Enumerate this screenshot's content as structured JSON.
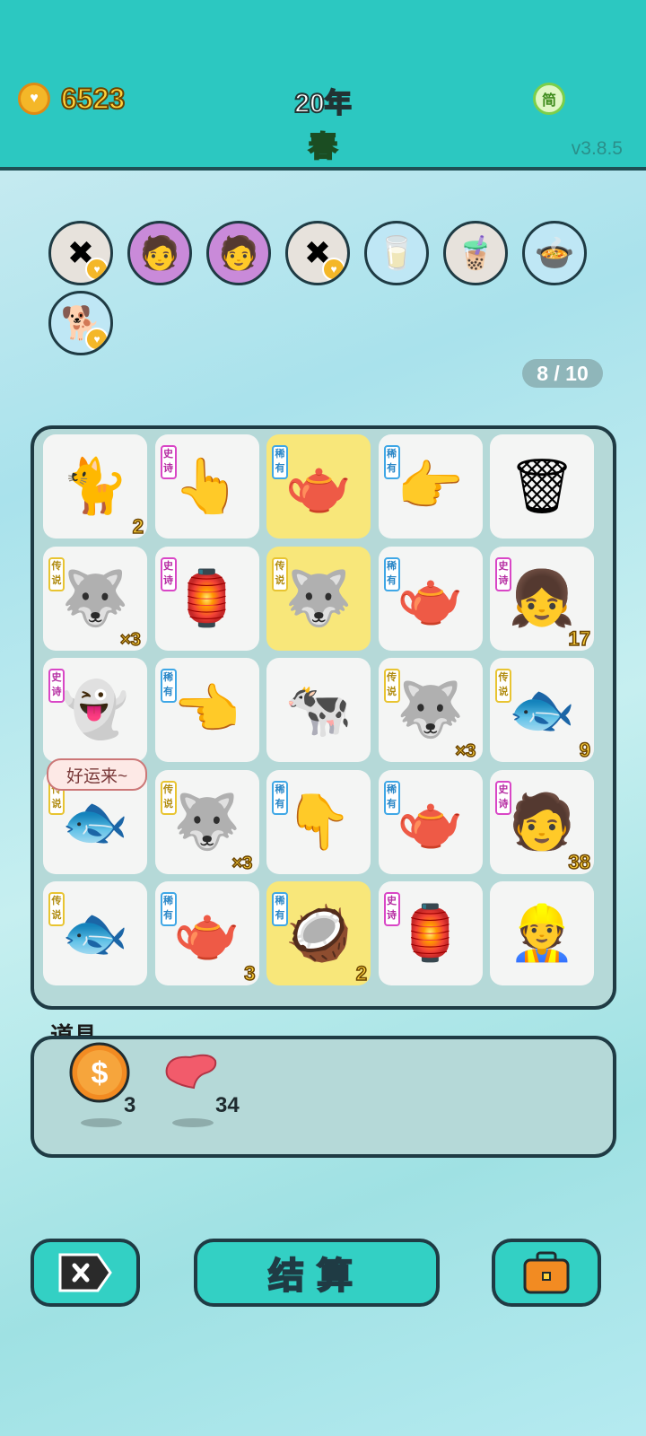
{
  "header": {
    "coins": "6523",
    "year": "20年",
    "season": "春",
    "lang": "简",
    "version": "v3.8.5"
  },
  "trail": [
    {
      "icon": "remove-tag-icon",
      "glyph": "✖"
    },
    {
      "icon": "lucky-man-icon",
      "glyph": "🧑"
    },
    {
      "icon": "lucky-man-icon",
      "glyph": "🧑"
    },
    {
      "icon": "remove-tag-icon",
      "glyph": "✖"
    },
    {
      "icon": "milk-jug-icon",
      "glyph": "🥛"
    },
    {
      "icon": "bubble-tea-icon",
      "glyph": "🧋"
    },
    {
      "icon": "duck-pot-icon",
      "glyph": "🍲"
    },
    {
      "icon": "husky-icon",
      "glyph": "🐕"
    }
  ],
  "spin_counter": "8 / 10",
  "board": [
    {
      "icon": "cat-icon",
      "glyph": "🐈",
      "count": "2"
    },
    {
      "icon": "pointing-hand-icon",
      "glyph": "👆",
      "tag": "史诗",
      "tagType": "epic"
    },
    {
      "icon": "teapot-icon",
      "glyph": "🫖",
      "tag": "稀有",
      "tagType": "rare",
      "highlight": true
    },
    {
      "icon": "pointing-hand-icon",
      "glyph": "👉",
      "tag": "稀有",
      "tagType": "rare"
    },
    {
      "icon": "garbage-bag-icon",
      "glyph": "🗑"
    },
    {
      "icon": "king-husky-icon",
      "glyph": "🐺",
      "tag": "传说",
      "tagType": "legend",
      "mult": "×3"
    },
    {
      "icon": "rabbit-house-icon",
      "glyph": "🏮",
      "tag": "史诗",
      "tagType": "epic"
    },
    {
      "icon": "king-husky-icon",
      "glyph": "🐺",
      "tag": "传说",
      "tagType": "legend",
      "highlight": true
    },
    {
      "icon": "teapot-icon",
      "glyph": "🫖",
      "tag": "稀有",
      "tagType": "rare"
    },
    {
      "icon": "girl-icon",
      "glyph": "👧",
      "tag": "史诗",
      "tagType": "epic",
      "count": "17"
    },
    {
      "icon": "ghost-icon",
      "glyph": "👻",
      "tag": "史诗",
      "tagType": "epic"
    },
    {
      "icon": "pointing-hand-icon",
      "glyph": "👈",
      "tag": "稀有",
      "tagType": "rare"
    },
    {
      "icon": "cow-icon",
      "glyph": "🐄"
    },
    {
      "icon": "king-husky-icon",
      "glyph": "🐺",
      "tag": "传说",
      "tagType": "legend",
      "mult": "×3"
    },
    {
      "icon": "koi-fish-icon",
      "glyph": "🐟",
      "tag": "传说",
      "tagType": "legend",
      "count": "9"
    },
    {
      "icon": "koi-fish-icon",
      "glyph": "🐟",
      "tag": "传说",
      "tagType": "legend"
    },
    {
      "icon": "king-husky-icon",
      "glyph": "🐺",
      "tag": "传说",
      "tagType": "legend",
      "mult": "×3"
    },
    {
      "icon": "pointing-hand-icon",
      "glyph": "👇",
      "tag": "稀有",
      "tagType": "rare"
    },
    {
      "icon": "teapot-icon",
      "glyph": "🫖",
      "tag": "稀有",
      "tagType": "rare"
    },
    {
      "icon": "lucky-man-icon",
      "glyph": "🧑",
      "tag": "史诗",
      "tagType": "epic",
      "count": "38"
    },
    {
      "icon": "koi-fish-icon",
      "glyph": "🐟",
      "tag": "传说",
      "tagType": "legend"
    },
    {
      "icon": "teapot-icon",
      "glyph": "🫖",
      "tag": "稀有",
      "tagType": "rare",
      "count": "3"
    },
    {
      "icon": "coconut-icon",
      "glyph": "🥥",
      "tag": "稀有",
      "tagType": "rare",
      "count": "2",
      "highlight": true
    },
    {
      "icon": "rabbit-house-icon",
      "glyph": "🏮",
      "tag": "史诗",
      "tagType": "epic"
    },
    {
      "icon": "worker-man-icon",
      "glyph": "👷"
    }
  ],
  "bubble_text": "好运来~",
  "items": {
    "title": "道具",
    "coin_qty": "3",
    "liver_qty": "34"
  },
  "buttons": {
    "settle": "结算"
  }
}
